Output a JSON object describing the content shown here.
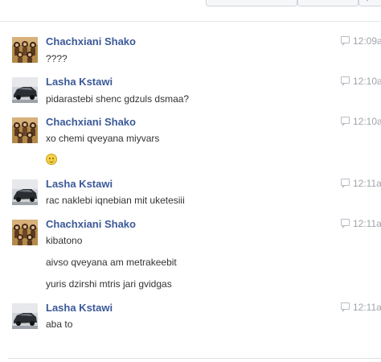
{
  "messages": [
    {
      "sender": "Chachxiani Shako",
      "avatar": "group-photo-avatar",
      "time": "12:09a",
      "lines": [
        "????"
      ]
    },
    {
      "sender": "Lasha Kstawi",
      "avatar": "car-photo-avatar",
      "time": "12:10a",
      "lines": [
        "pidarastebi shenc gdzuls dsmaa?"
      ]
    },
    {
      "sender": "Chachxiani Shako",
      "avatar": "group-photo-avatar",
      "time": "12:10a",
      "lines": [
        "xo chemi qveyana miyvars"
      ],
      "emoji": "smiley-icon"
    },
    {
      "sender": "Lasha Kstawi",
      "avatar": "car-photo-avatar",
      "time": "12:11a",
      "lines": [
        "rac naklebi iqnebian mit uketesiii"
      ]
    },
    {
      "sender": "Chachxiani Shako",
      "avatar": "group-photo-avatar",
      "time": "12:11a",
      "lines": [
        "kibatono",
        "aivso qveyana am metrakeebit",
        "yuris dzirshi mtris jari gvidgas"
      ]
    },
    {
      "sender": "Lasha Kstawi",
      "avatar": "car-photo-avatar",
      "time": "12:11a",
      "lines": [
        "aba to"
      ]
    }
  ],
  "colors": {
    "sender_name": "#3b5998",
    "message_text": "#333333",
    "timestamp": "#a0a4aa"
  }
}
